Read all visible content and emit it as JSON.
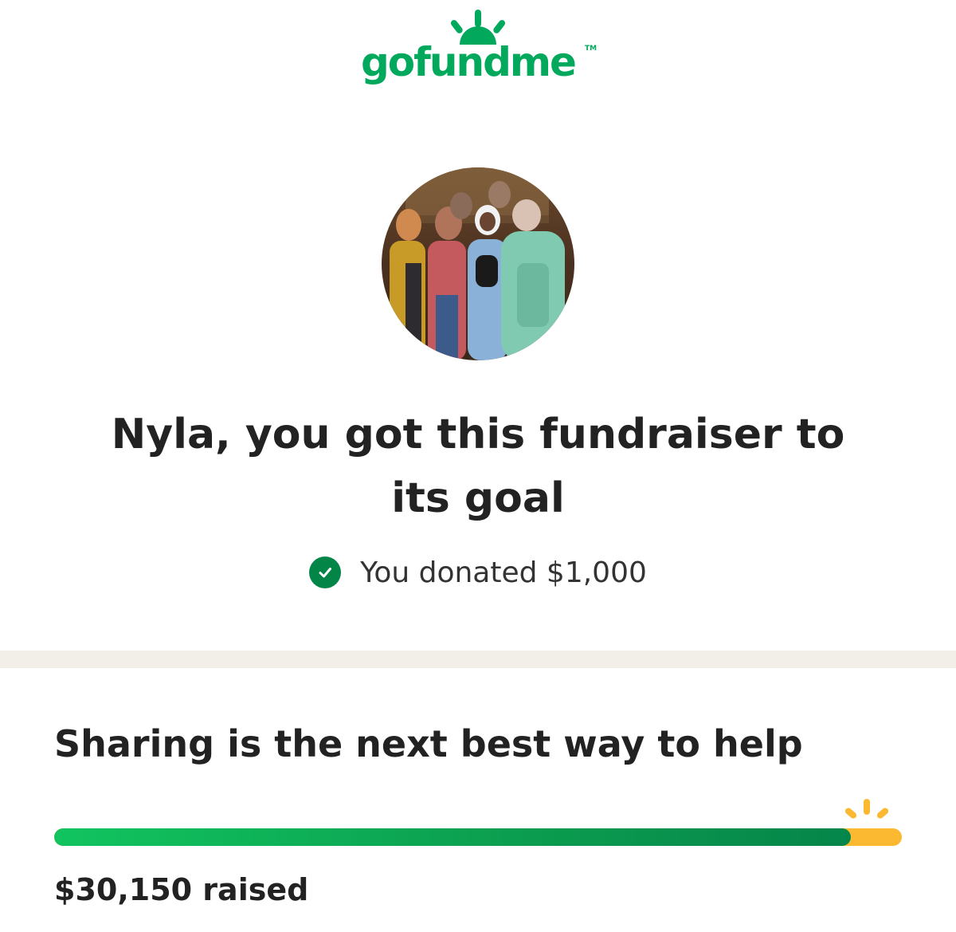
{
  "brand": {
    "logo_text": "gofundme",
    "trademark": "TM",
    "color": "#02a95c"
  },
  "campaign": {
    "avatar_icon": "campaign-photo"
  },
  "headline": {
    "line1": "Nyla, you got this fundraiser to",
    "line2": "its goal"
  },
  "donation": {
    "status_icon": "checkmark-icon",
    "text": "You donated $1,000"
  },
  "share": {
    "title": "Sharing is the next best way to help"
  },
  "progress": {
    "percent": 94,
    "raised_text": "$30,150 raised",
    "fill_color": "#0b9c4f",
    "track_color": "#fbb931"
  }
}
